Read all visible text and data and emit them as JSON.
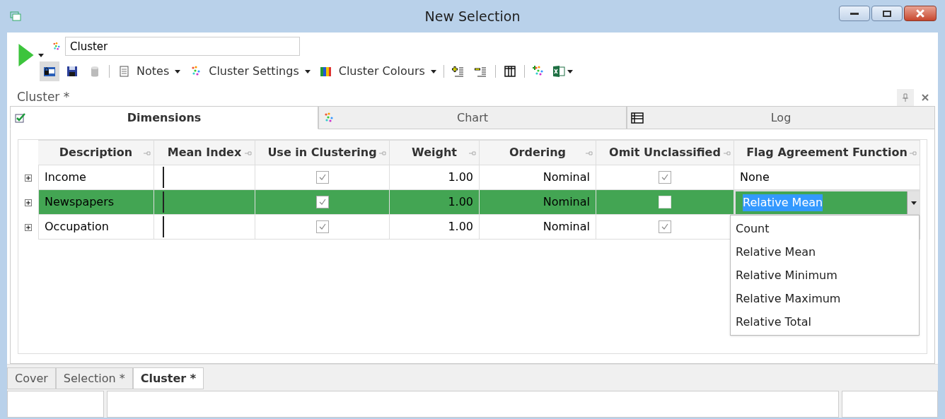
{
  "window": {
    "title": "New Selection"
  },
  "toolbar": {
    "name_field": {
      "value": "Cluster"
    },
    "items": [
      {
        "kind": "icon",
        "selected": true
      },
      {
        "kind": "icon",
        "selected": false
      },
      {
        "kind": "icon",
        "selected": false
      },
      {
        "kind": "separator"
      },
      {
        "kind": "menu",
        "label": "Notes"
      },
      {
        "kind": "menu",
        "label": "Cluster Settings"
      },
      {
        "kind": "menu",
        "label": "Cluster Colours"
      },
      {
        "kind": "separator"
      },
      {
        "kind": "icon",
        "selected": false
      },
      {
        "kind": "icon",
        "selected": false
      },
      {
        "kind": "separator"
      },
      {
        "kind": "icon",
        "selected": false
      },
      {
        "kind": "separator"
      },
      {
        "kind": "icon",
        "selected": false
      },
      {
        "kind": "dropicon"
      }
    ]
  },
  "document": {
    "title": "Cluster *"
  },
  "tabs": [
    {
      "label": "Dimensions",
      "selected": true
    },
    {
      "label": "Chart",
      "selected": false
    },
    {
      "label": "Log",
      "selected": false
    }
  ],
  "table": {
    "columns": [
      {
        "label": "Description"
      },
      {
        "label": "Mean Index"
      },
      {
        "label": "Use in Clustering"
      },
      {
        "label": "Weight"
      },
      {
        "label": "Ordering"
      },
      {
        "label": "Omit Unclassified"
      },
      {
        "label": "Flag Agreement Function"
      }
    ],
    "rows": [
      {
        "description": "Income",
        "use_in_clustering": true,
        "weight": "1.00",
        "ordering": "Nominal",
        "omit_unclassified": true,
        "flag_function": "None",
        "selected": false,
        "editing": false
      },
      {
        "description": "Newspapers",
        "use_in_clustering": true,
        "weight": "1.00",
        "ordering": "Nominal",
        "omit_unclassified": false,
        "flag_function": "Relative Mean",
        "selected": true,
        "editing": true
      },
      {
        "description": "Occupation",
        "use_in_clustering": true,
        "weight": "1.00",
        "ordering": "Nominal",
        "omit_unclassified": true,
        "flag_function": "",
        "selected": false,
        "editing": false
      }
    ]
  },
  "dropdown": {
    "options": [
      "Count",
      "Relative Mean",
      "Relative Minimum",
      "Relative Maximum",
      "Relative Total"
    ]
  },
  "sheet_tabs": [
    {
      "label": "Cover",
      "selected": false
    },
    {
      "label": "Selection *",
      "selected": false
    },
    {
      "label": "Cluster *",
      "selected": true
    }
  ]
}
